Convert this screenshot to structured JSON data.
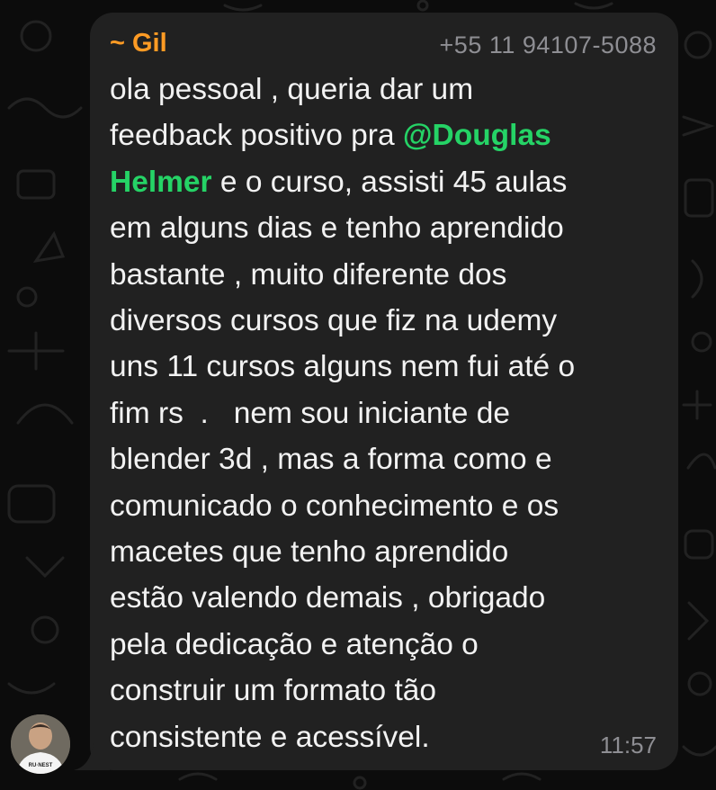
{
  "chat": {
    "sender": "~ Gil",
    "phone": "+55 11 94107-5088",
    "message": {
      "line1": "ola pessoal , queria dar um",
      "line2_pre": "feedback positivo pra ",
      "mention_part1": "@Douglas",
      "mention_part2": "Helmer",
      "line3_post": " e o curso, assisti 45 aulas",
      "line4": "em alguns dias e tenho aprendido",
      "line5": "bastante , muito diferente dos",
      "line6": "diversos cursos que fiz na udemy",
      "line7": "uns 11 cursos alguns nem fui até o",
      "line8": "fim rs  .   nem sou iniciante de",
      "line9": "blender 3d , mas a forma como e",
      "line10": "comunicado o conhecimento e os",
      "line11": "macetes que tenho aprendido",
      "line12": "estão valendo demais , obrigado",
      "line13": "pela dedicação e atenção o",
      "line14": "construir um formato tão",
      "line15": "consistente e acessível."
    },
    "time": "11:57",
    "avatar_shirt_text": "RU·NEST"
  },
  "colors": {
    "background": "#0c0c0c",
    "bubble": "#212121",
    "sender": "#ff9b24",
    "mention": "#25d366",
    "text": "#f2f2f2",
    "meta": "#8e8e93"
  }
}
